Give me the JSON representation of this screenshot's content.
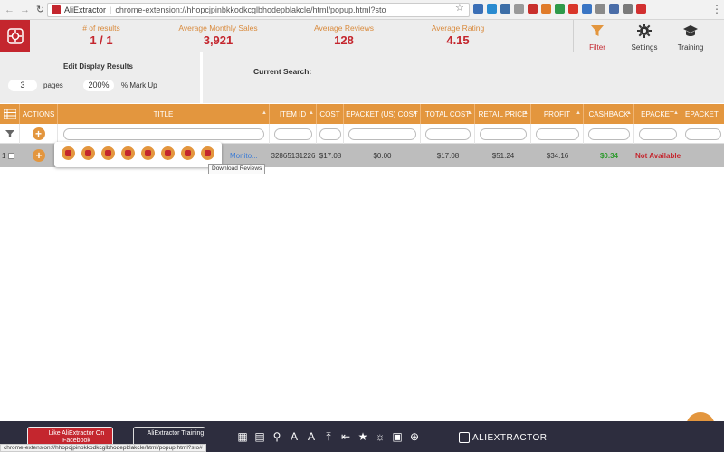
{
  "browser": {
    "app_name": "AliExtractor",
    "separator": "|",
    "url": "chrome-extension://hhopcjpinbkkodkcglbhodepblakcle/html/popup.html?sto",
    "status_url": "chrome-extension://hhopcjpinbkkodkcglbhodepblakcle/html/popup.html?sto#"
  },
  "stats": [
    {
      "label": "# of results",
      "value": "1 / 1"
    },
    {
      "label": "Average Monthly Sales",
      "value": "3,921"
    },
    {
      "label": "Average Reviews",
      "value": "128"
    },
    {
      "label": "Average Rating",
      "value": "4.15"
    }
  ],
  "toolbar": {
    "filter_label": "Filter",
    "settings_label": "Settings",
    "training_label": "Training"
  },
  "display": {
    "title": "Edit Display Results",
    "pages_value": "3",
    "pages_label": "pages",
    "markup_value": "200%",
    "markup_label": "% Mark Up"
  },
  "current_search_label": "Current Search:",
  "table": {
    "headers": [
      "ACTIONS",
      "TITLE",
      "ITEM ID",
      "COST",
      "EPACKET (US) COST",
      "TOTAL COST",
      "RETAIL PRICE",
      "PROFIT",
      "CASHBACK",
      "EPACKET",
      "EPACKET"
    ],
    "row": {
      "index": "1",
      "title": "Monito...",
      "item_id": "32865131226",
      "cost": "$17.08",
      "epacket_cost": "$0.00",
      "total_cost": "$17.08",
      "retail_price": "$51.24",
      "profit": "$34.16",
      "cashback": "$0.34",
      "epacket": "Not Available"
    }
  },
  "tooltip": "Download Reviews",
  "bottom": {
    "facebook_label": "Like AliExtractor On Facebook",
    "training_label": "AliExtractor Training",
    "brand": "ALIEXTRACTOR"
  },
  "colors": {
    "brand_red": "#c4262e",
    "orange": "#e3963e",
    "cashback_green": "#2e9a2e",
    "dark_bar": "#2d2d3e"
  }
}
